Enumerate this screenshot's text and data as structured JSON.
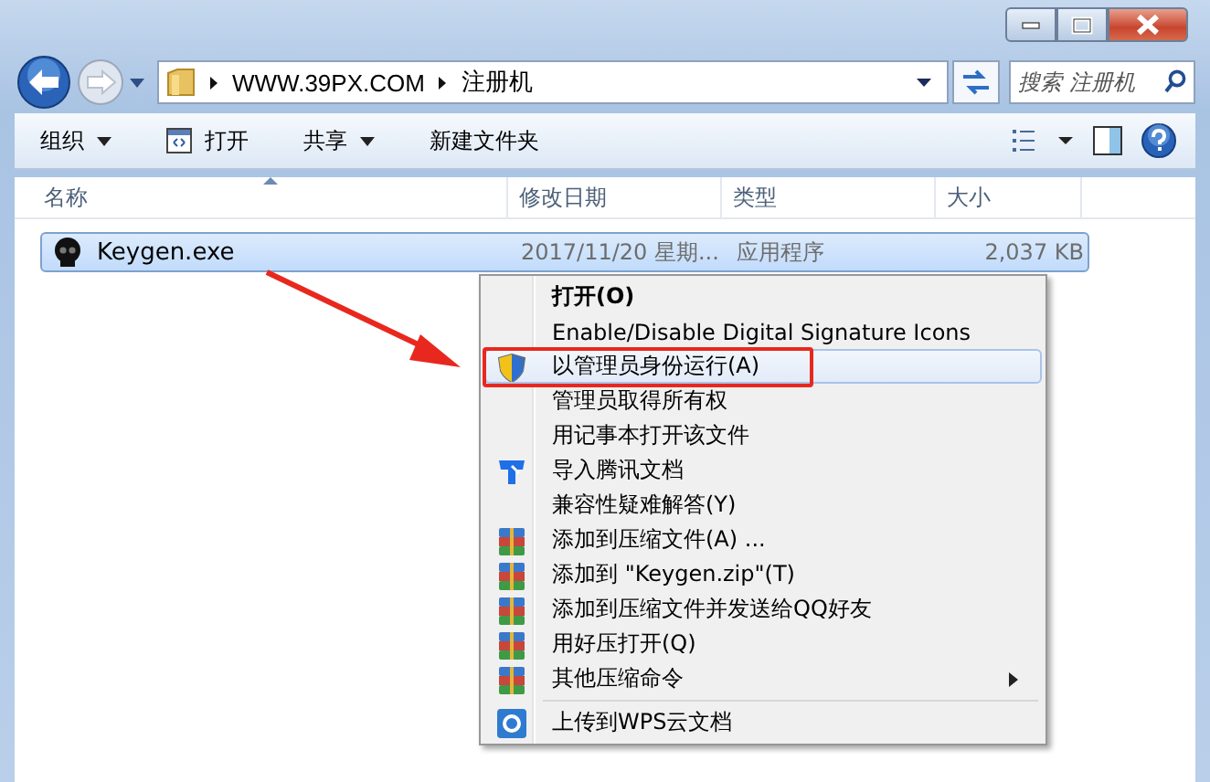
{
  "address_bar": {
    "path": [
      "WWW.39PX.COM",
      "注册机"
    ]
  },
  "search": {
    "placeholder": "搜索 注册机"
  },
  "toolbar": {
    "items": [
      {
        "label": "组织",
        "dropdown": true,
        "kind": "plain"
      },
      {
        "label": "打开",
        "dropdown": false,
        "kind": "open"
      },
      {
        "label": "共享",
        "dropdown": true,
        "kind": "plain"
      },
      {
        "label": "新建文件夹",
        "dropdown": false,
        "kind": "plain"
      }
    ]
  },
  "table": {
    "columns": [
      "名称",
      "修改日期",
      "类型",
      "大小"
    ],
    "rows": [
      {
        "selected": true,
        "cells": [
          "Keygen.exe",
          "2017/11/20 星期...",
          "应用程序",
          "2,037 KB"
        ]
      }
    ]
  },
  "context_menu": {
    "items": [
      {
        "label": "打开(O)",
        "kind": "plain",
        "default": true,
        "selected": false,
        "submenu": false
      },
      {
        "label": "Enable/Disable Digital Signature Icons",
        "kind": "plain",
        "default": false,
        "selected": false,
        "submenu": false
      },
      {
        "label": "以管理员身份运行(A)",
        "kind": "shield",
        "default": false,
        "selected": true,
        "submenu": false
      },
      {
        "label": "管理员取得所有权",
        "kind": "plain",
        "default": false,
        "selected": false,
        "submenu": false
      },
      {
        "label": "用记事本打开该文件",
        "kind": "plain",
        "default": false,
        "selected": false,
        "submenu": false
      },
      {
        "label": "导入腾讯文档",
        "kind": "docs",
        "default": false,
        "selected": false,
        "submenu": false
      },
      {
        "label": "兼容性疑难解答(Y)",
        "kind": "plain",
        "default": false,
        "selected": false,
        "submenu": false
      },
      {
        "label": "添加到压缩文件(A) ...",
        "kind": "archive",
        "default": false,
        "selected": false,
        "submenu": false
      },
      {
        "label": "添加到 \"Keygen.zip\"(T)",
        "kind": "archive",
        "default": false,
        "selected": false,
        "submenu": false
      },
      {
        "label": "添加到压缩文件并发送给QQ好友",
        "kind": "archive",
        "default": false,
        "selected": false,
        "submenu": false
      },
      {
        "label": "用好压打开(Q)",
        "kind": "archive",
        "default": false,
        "selected": false,
        "submenu": false
      },
      {
        "label": "其他压缩命令",
        "kind": "archive",
        "default": false,
        "selected": false,
        "submenu": true
      },
      {
        "kind": "separator"
      },
      {
        "label": "上传到WPS云文档",
        "kind": "cloud",
        "default": false,
        "selected": false,
        "submenu": false
      }
    ]
  }
}
